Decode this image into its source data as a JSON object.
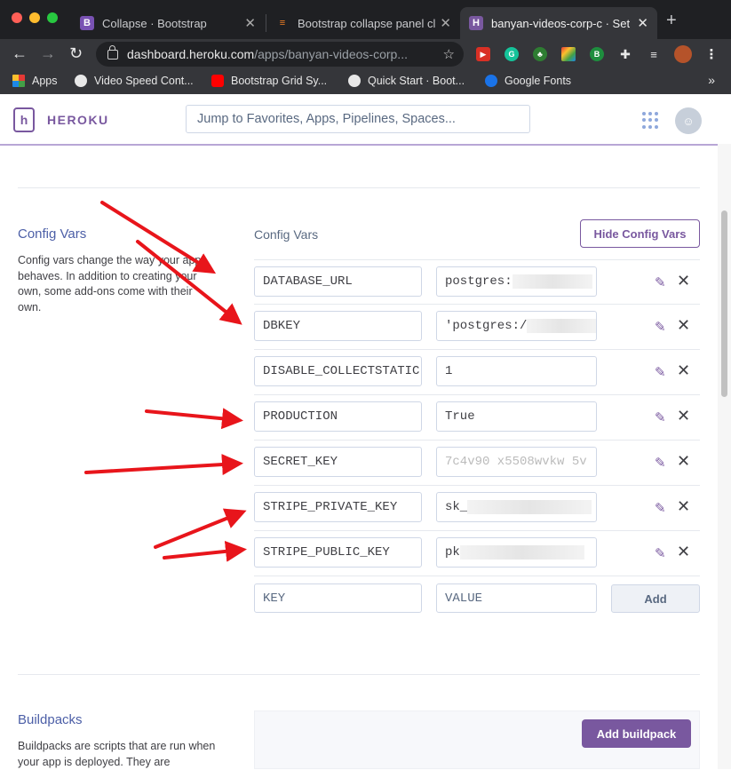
{
  "browser": {
    "tabs": [
      {
        "title": "Collapse · Bootstrap",
        "favicon": "B"
      },
      {
        "title": "Bootstrap collapse panel cl",
        "favicon": "stack-overflow-icon"
      },
      {
        "title": "banyan-videos-corp-c · Set",
        "favicon": "H"
      }
    ],
    "url_host": "dashboard.heroku.com",
    "url_path": "/apps/banyan-videos-corp...",
    "bookmarks": [
      "Apps",
      "Video Speed Cont...",
      "Bootstrap Grid Sy...",
      "Quick Start · Boot...",
      "Google Fonts"
    ],
    "more": "»"
  },
  "header": {
    "brand": "HEROKU",
    "search_placeholder": "Jump to Favorites, Apps, Pipelines, Spaces..."
  },
  "config_vars": {
    "section_title": "Config Vars",
    "description": "Config vars change the way your app behaves. In addition to creating your own, some add-ons come with their own.",
    "panel_title": "Config Vars",
    "hide_button": "Hide Config Vars",
    "rows": [
      {
        "key": "DATABASE_URL",
        "value": "postgres:"
      },
      {
        "key": "DBKEY",
        "value": "'postgres:/"
      },
      {
        "key": "DISABLE_COLLECTSTATIC",
        "value": "1"
      },
      {
        "key": "PRODUCTION",
        "value": "True"
      },
      {
        "key": "SECRET_KEY",
        "value": "7c4v90 x5508wvkw 5v"
      },
      {
        "key": "STRIPE_PRIVATE_KEY",
        "value": "sk_"
      },
      {
        "key": "STRIPE_PUBLIC_KEY",
        "value": "pk"
      }
    ],
    "new_key_placeholder": "KEY",
    "new_value_placeholder": "VALUE",
    "add_button": "Add"
  },
  "buildpacks": {
    "section_title": "Buildpacks",
    "description": "Buildpacks are scripts that are run when your app is deployed. They are",
    "add_button": "Add buildpack"
  },
  "colors": {
    "heroku_purple": "#79589f",
    "arrow_red": "#e8151b",
    "link_blue": "#4c5fa7"
  }
}
